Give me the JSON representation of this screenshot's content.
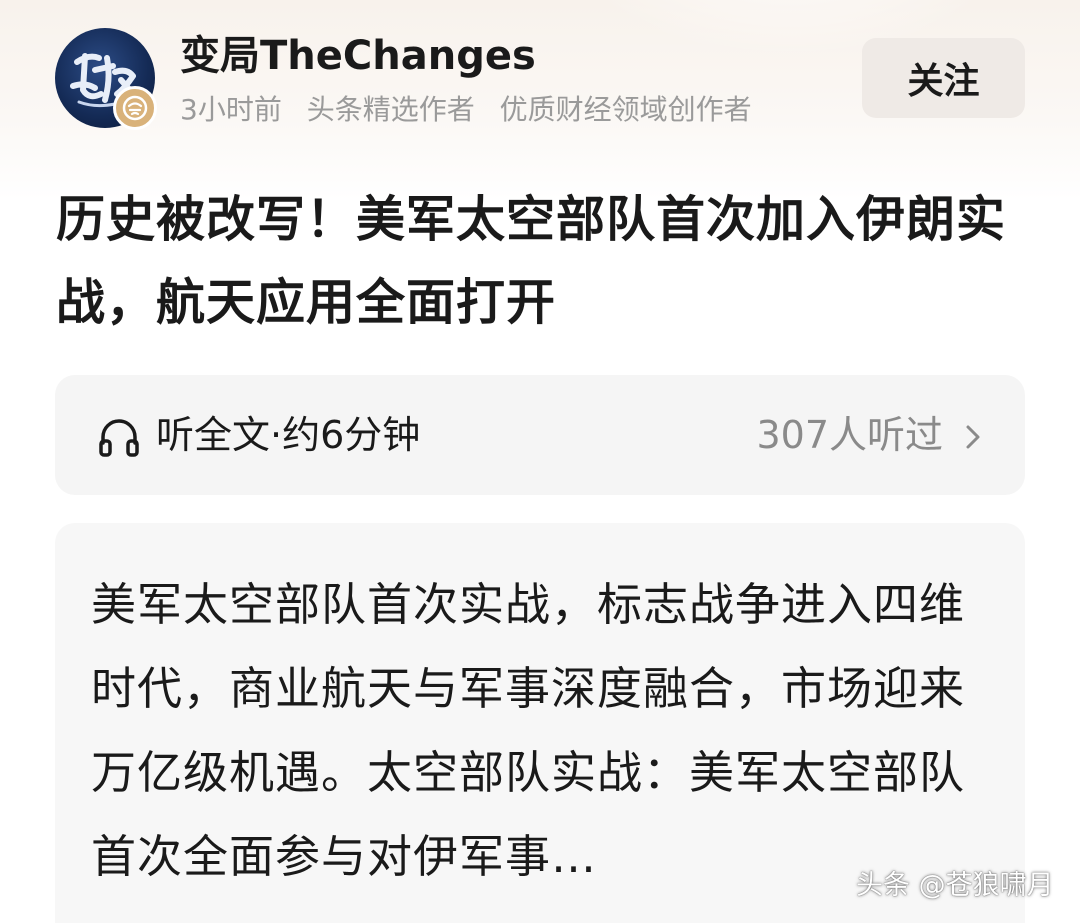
{
  "author": {
    "name": "变局TheChanges",
    "time": "3小时前",
    "tags": [
      "头条精选作者",
      "优质财经领域创作者"
    ],
    "follow_label": "关注"
  },
  "article": {
    "title": "历史被改写！美军太空部队首次加入伊朗实战，航天应用全面打开"
  },
  "listen": {
    "label": "听全文·约6分钟",
    "count": "307人听过"
  },
  "summary": {
    "text": "美军太空部队首次实战，标志战争进入四维时代，商业航天与军事深度融合，市场迎来万亿级机遇。太空部队实战：美军太空部队首次全面参与对伊军事…"
  },
  "watermark": "头条 @苍狼啸月",
  "icons": {
    "headphone": "headphone-icon",
    "chevron": "chevron-right-icon",
    "verified": "verified-badge-icon"
  },
  "colors": {
    "follow_bg": "#efeae6",
    "muted_text": "#9a9a9a",
    "card_bg": "#f7f7f7",
    "badge": "#d9b27a"
  }
}
